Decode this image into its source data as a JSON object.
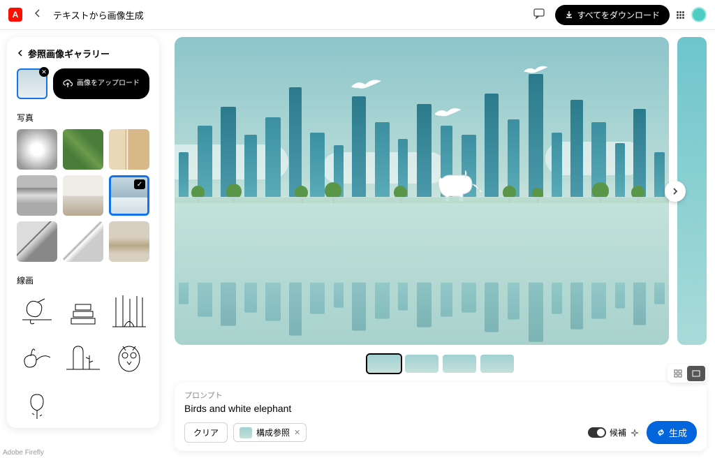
{
  "header": {
    "page_title": "テキストから画像生成",
    "download_label": "すべてをダウンロード"
  },
  "sidebar": {
    "title": "参照画像ギャラリー",
    "upload_label": "画像をアップロード",
    "category_photo": "写真",
    "category_line": "線画",
    "photo_thumbs": [
      {
        "name": "hallway",
        "selected": false
      },
      {
        "name": "field-aerial",
        "selected": false
      },
      {
        "name": "cat-window",
        "selected": false
      },
      {
        "name": "river-mountains",
        "selected": false
      },
      {
        "name": "living-room",
        "selected": false
      },
      {
        "name": "city-skyline",
        "selected": true
      },
      {
        "name": "buildings-bw",
        "selected": false
      },
      {
        "name": "modern-architecture",
        "selected": false
      },
      {
        "name": "desert-dunes",
        "selected": false
      }
    ],
    "line_thumbs": [
      {
        "name": "bird-branch"
      },
      {
        "name": "books-stack"
      },
      {
        "name": "forest-path"
      },
      {
        "name": "swan"
      },
      {
        "name": "cacti"
      },
      {
        "name": "owl"
      },
      {
        "name": "rose"
      }
    ]
  },
  "prompt": {
    "label": "プロンプト",
    "text": "Birds and white elephant",
    "clear_label": "クリア",
    "ref_chip_label": "構成参照",
    "suggestion_label": "候補",
    "generate_label": "生成"
  },
  "result_thumbs": [
    {
      "active": true
    },
    {
      "active": false
    },
    {
      "active": false
    },
    {
      "active": false
    }
  ],
  "footer": "Adobe Firefly"
}
